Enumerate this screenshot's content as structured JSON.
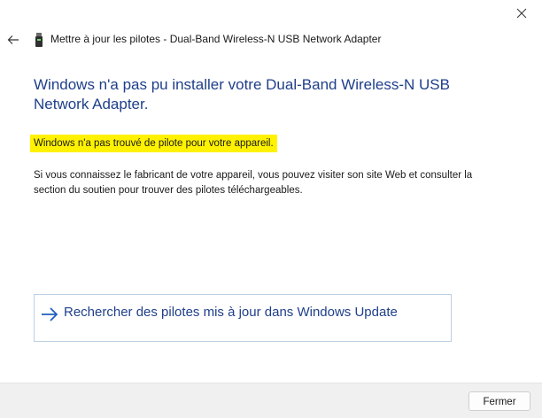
{
  "window": {
    "close_icon": "close-icon"
  },
  "header": {
    "back_icon": "back-arrow-icon",
    "device_icon": "usb-device-icon",
    "title": "Mettre à jour les pilotes - Dual-Band Wireless-N USB Network Adapter"
  },
  "content": {
    "main_title": "Windows n'a pas pu installer votre Dual-Band Wireless-N USB Network Adapter.",
    "highlighted_message": "Windows n'a pas trouvé de pilote pour votre appareil.",
    "description": "Si vous connaissez le fabricant de votre appareil, vous pouvez visiter son site Web et consulter la section du soutien pour trouver des pilotes téléchargeables.",
    "windows_update_link": "Rechercher des pilotes mis à jour dans Windows Update",
    "link_icon": "arrow-right-icon"
  },
  "footer": {
    "close_label": "Fermer"
  },
  "colors": {
    "accent": "#1f3f8a",
    "highlight": "#fff200",
    "link_border": "#bcd0e3",
    "footer_bg": "#f0f0f0"
  }
}
